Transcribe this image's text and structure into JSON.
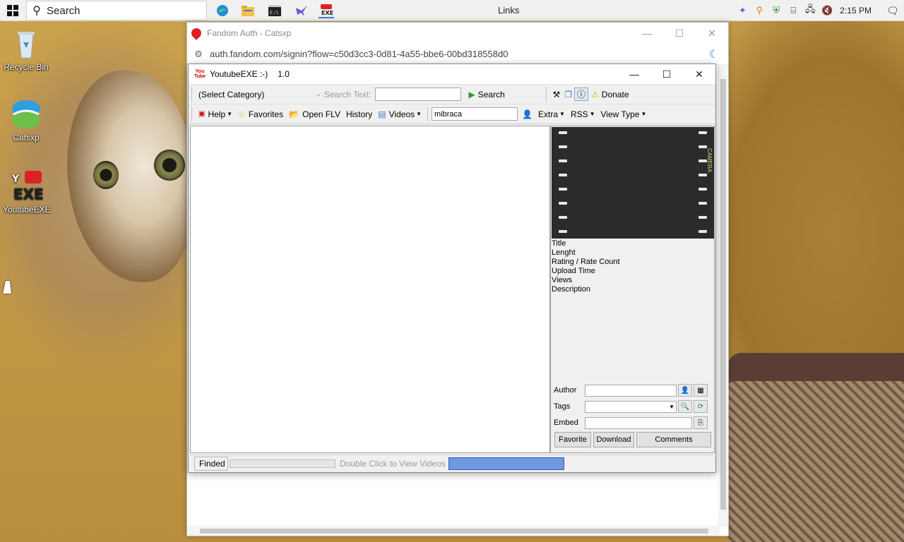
{
  "taskbar": {
    "search_label": "Search",
    "center_label": "Links",
    "clock": "2:15 PM"
  },
  "desktop": {
    "icons": [
      {
        "label": "Recycle Bin"
      },
      {
        "label": "Catsxp"
      },
      {
        "label": "YoutubeEXE"
      }
    ]
  },
  "browser": {
    "title": "Fandom Auth - Catsxp",
    "url": "auth.fandom.com/signin?flow=c50d3cc3-0d81-4a55-bbe6-00bd318558d0"
  },
  "app": {
    "title": "YoutubeEXE :-)",
    "version": "1.0",
    "toolbar1": {
      "category": "(Select Category)",
      "search_text_label": "Search Text:",
      "search_value": "",
      "search_button": "Search",
      "donate": "Donate"
    },
    "toolbar2": {
      "help": "Help",
      "favorites": "Favorites",
      "open_flv": "Open FLV",
      "history": "History",
      "videos": "Videos",
      "query": "mibraca",
      "extra": "Extra",
      "rss": "RSS",
      "view_type": "View Type"
    },
    "player_tag": "CAMERA",
    "info_fields": [
      "Title",
      "Lenght",
      "Rating / Rate Count",
      "Upload Time",
      "Views",
      "Description"
    ],
    "meta": {
      "author_label": "Author",
      "author_value": "",
      "tags_label": "Tags",
      "tags_value": "",
      "embed_label": "Embed",
      "embed_value": ""
    },
    "buttons": {
      "favorite": "Favorite",
      "download": "Download",
      "comments": "Comments"
    },
    "status": {
      "state": "Finded",
      "progress": 0,
      "hint": "Double Click to View Videos"
    }
  }
}
